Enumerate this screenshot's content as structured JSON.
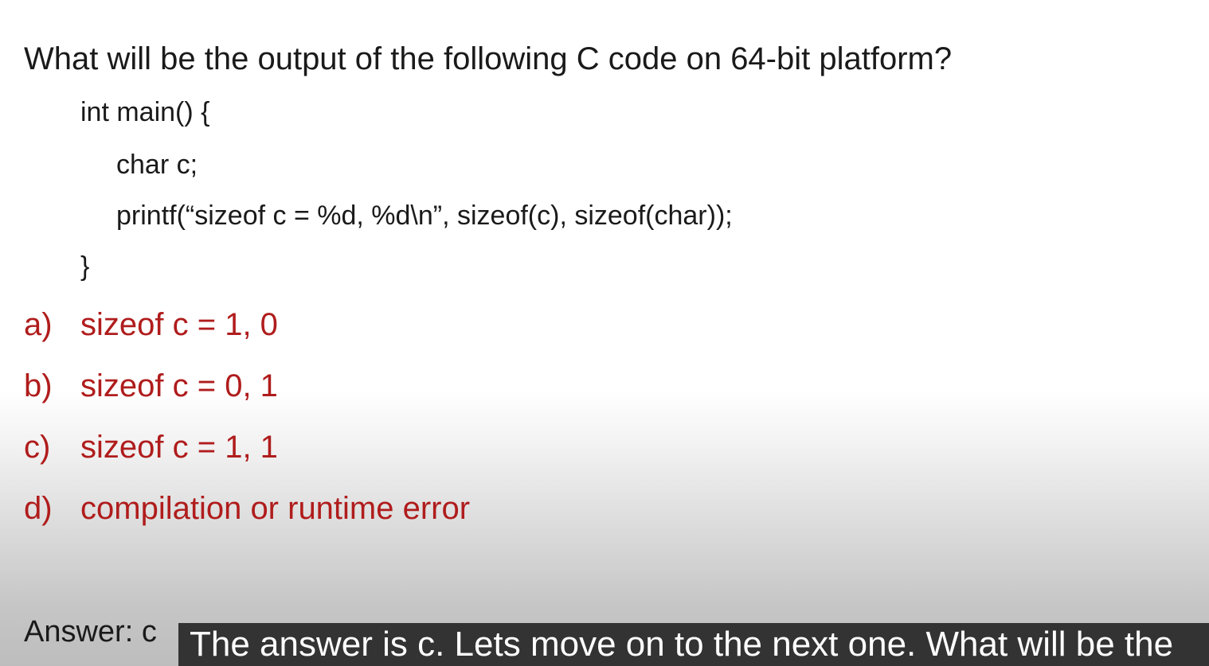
{
  "slide": {
    "question": "What will be the output of the following C code on 64-bit platform?",
    "code_lines": [
      "int main() {",
      "char c;",
      "printf(“sizeof c = %d, %d\\n”, sizeof(c), sizeof(char));",
      "}"
    ],
    "options": [
      {
        "marker": "a)",
        "text": "sizeof c = 1, 0"
      },
      {
        "marker": "b)",
        "text": "sizeof c = 0, 1"
      },
      {
        "marker": "c)",
        "text": "sizeof c = 1, 1"
      },
      {
        "marker": "d)",
        "text": "compilation or runtime error"
      }
    ],
    "answer": "Answer: c",
    "option_color": "#b01c1c"
  },
  "caption": {
    "text": "The answer is c. Lets move on to the next one. What will be the"
  }
}
